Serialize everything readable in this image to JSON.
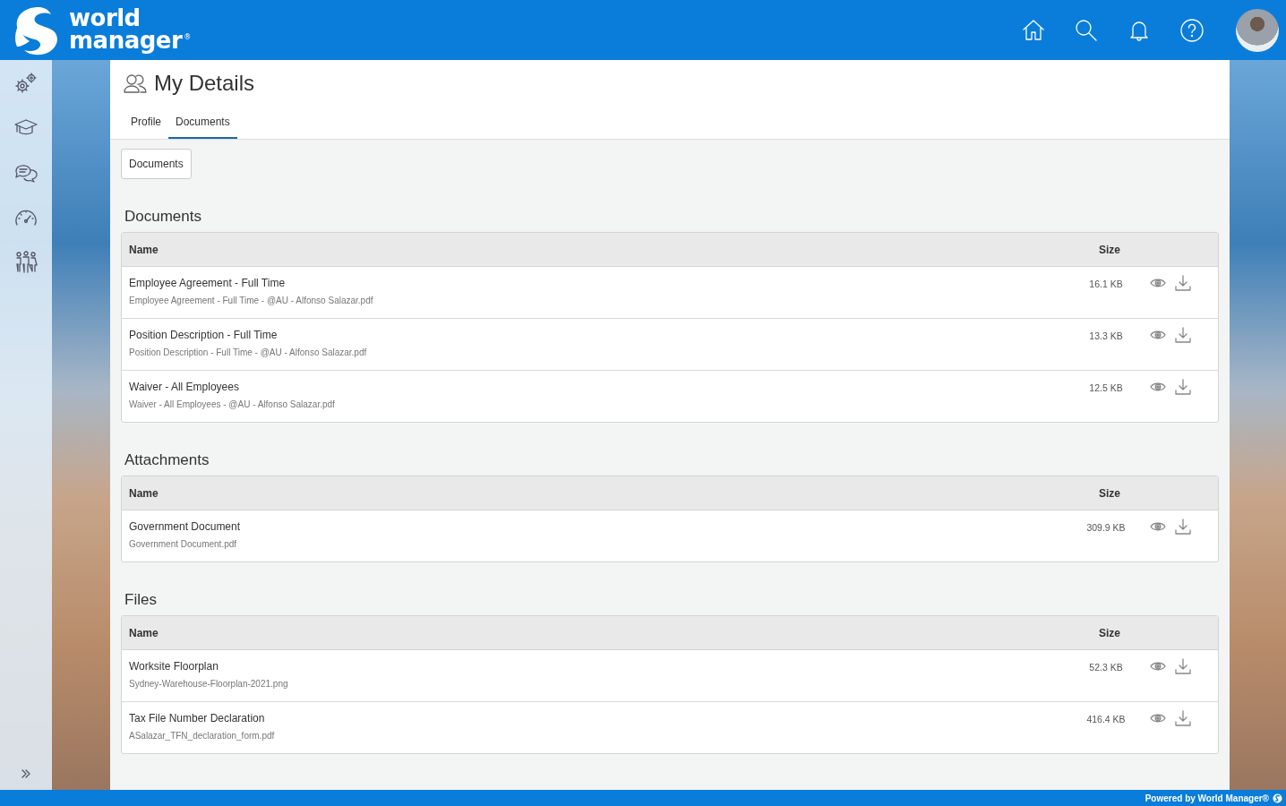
{
  "header": {
    "logo": {
      "line1": "world",
      "line2": "manager",
      "mark": "®"
    }
  },
  "sidebar": {
    "items": [
      {
        "kind": "gears"
      },
      {
        "kind": "training"
      },
      {
        "kind": "chat"
      },
      {
        "kind": "gauge"
      },
      {
        "kind": "people"
      }
    ]
  },
  "page": {
    "title": "My Details",
    "tabs": [
      {
        "label": "Profile",
        "selected": false
      },
      {
        "label": "Documents",
        "selected": true
      }
    ],
    "filter_button": "Documents",
    "sections": [
      {
        "title": "Documents",
        "columns": [
          "Name",
          "Size"
        ],
        "rows": [
          {
            "name": "Employee Agreement - Full Time",
            "file": "Employee Agreement - Full Time - @AU - Alfonso Salazar.pdf",
            "size": "16.1 KB"
          },
          {
            "name": "Position Description - Full Time",
            "file": "Position Description - Full Time - @AU - Alfonso Salazar.pdf",
            "size": "13.3 KB"
          },
          {
            "name": "Waiver - All Employees",
            "file": "Waiver - All Employees - @AU - Alfonso Salazar.pdf",
            "size": "12.5 KB"
          }
        ]
      },
      {
        "title": "Attachments",
        "columns": [
          "Name",
          "Size"
        ],
        "rows": [
          {
            "name": "Government Document",
            "file": "Government Document.pdf",
            "size": "309.9 KB"
          }
        ]
      },
      {
        "title": "Files",
        "columns": [
          "Name",
          "Size"
        ],
        "rows": [
          {
            "name": "Worksite Floorplan",
            "file": "Sydney-Warehouse-Floorplan-2021.png",
            "size": "52.3 KB"
          },
          {
            "name": "Tax File Number Declaration",
            "file": "ASalazar_TFN_declaration_form.pdf",
            "size": "416.4 KB"
          }
        ]
      }
    ]
  },
  "footer": {
    "text": "Powered by World Manager®"
  }
}
